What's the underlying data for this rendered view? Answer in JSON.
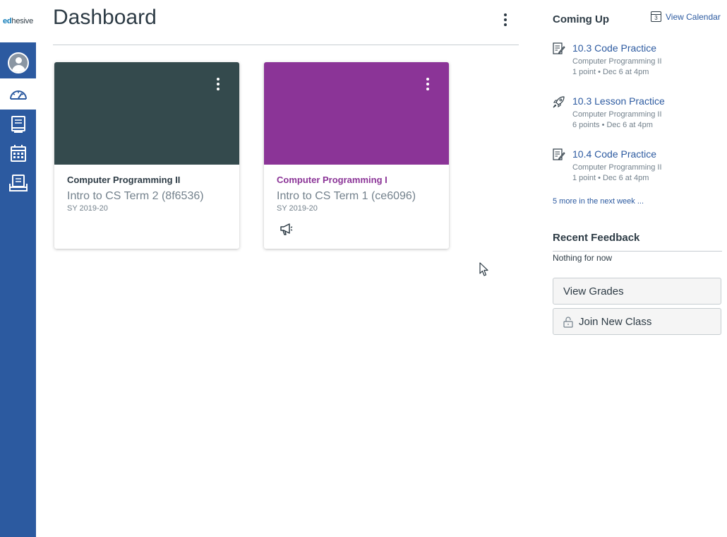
{
  "brand": {
    "prefix": "ed",
    "suffix": "hesive"
  },
  "global_nav": [
    {
      "name": "account",
      "icon": "avatar-icon",
      "active": false
    },
    {
      "name": "dashboard",
      "icon": "dashboard-gauge-icon",
      "active": true
    },
    {
      "name": "courses",
      "icon": "courses-book-icon",
      "active": false
    },
    {
      "name": "calendar",
      "icon": "calendar-grid-icon",
      "active": false
    },
    {
      "name": "inbox",
      "icon": "inbox-icon",
      "active": false
    }
  ],
  "header": {
    "title": "Dashboard",
    "menu_icon": "kebab-menu-icon"
  },
  "cards": [
    {
      "course": "Computer Programming II",
      "term": "Intro to CS Term 2 (8f6536)",
      "sy": "SY 2019-20",
      "color": "#344a4d",
      "course_color": "#2d3b45",
      "has_announcement": false
    },
    {
      "course": "Computer Programming I",
      "term": "Intro to CS Term 1 (ce6096)",
      "sy": "SY 2019-20",
      "color": "#8b3497",
      "course_color": "#8b3497",
      "has_announcement": true
    }
  ],
  "sidebar": {
    "coming_up_title": "Coming Up",
    "view_calendar": "View Calendar",
    "calendar_day": "3",
    "todos": [
      {
        "title": "10.3 Code Practice",
        "course": "Computer Programming II",
        "meta": "1 point • Dec 6 at 4pm",
        "icon": "assignment-icon"
      },
      {
        "title": "10.3 Lesson Practice",
        "course": "Computer Programming II",
        "meta": "6 points • Dec 6 at 4pm",
        "icon": "quiz-rocket-icon"
      },
      {
        "title": "10.4 Code Practice",
        "course": "Computer Programming II",
        "meta": "1 point • Dec 6 at 4pm",
        "icon": "assignment-icon"
      }
    ],
    "more_link": "5 more in the next week ...",
    "recent_feedback_title": "Recent Feedback",
    "nothing": "Nothing for now",
    "view_grades": "View Grades",
    "join_new_class": "Join New Class"
  },
  "colors": {
    "nav_bg": "#2c5aa0",
    "link": "#2c5aa0",
    "text": "#2d3b45",
    "muted": "#73818c"
  }
}
